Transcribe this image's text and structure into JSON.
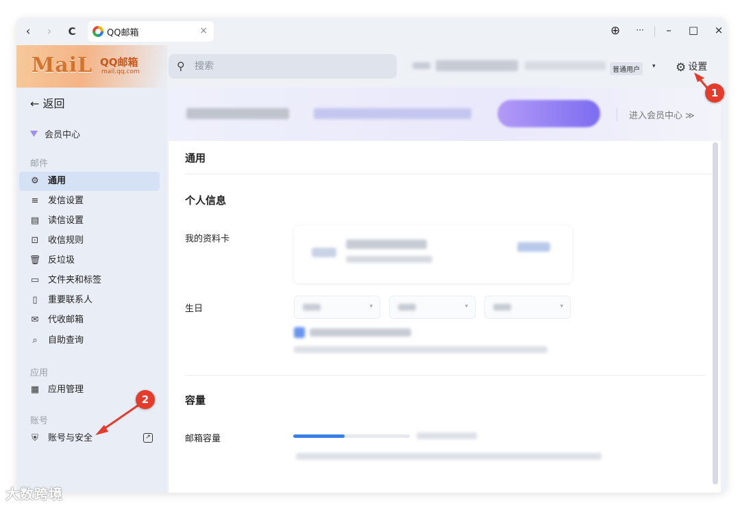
{
  "browser": {
    "back": "‹",
    "forward": "›",
    "reload": "C",
    "tab_title": "QQ邮箱",
    "tab_close": "×",
    "globe": "⊕",
    "more": "···",
    "minimize": "–",
    "maximize": "□",
    "close": "×"
  },
  "logo": {
    "wordmark": "MaiL",
    "brand": "QQ邮箱",
    "url": "mail.qq.com"
  },
  "header": {
    "search_placeholder": "搜索",
    "user_type": "普通用户",
    "user_caret": "▾",
    "settings_label": "设置"
  },
  "sidebar": {
    "back_label": "← 返回",
    "member_label": "会员中心",
    "sections": {
      "mail": "邮件",
      "apps": "应用",
      "account": "账号"
    },
    "items": [
      {
        "label": "通用",
        "icon": "⚙"
      },
      {
        "label": "发信设置",
        "icon": "≡"
      },
      {
        "label": "读信设置",
        "icon": "▤"
      },
      {
        "label": "收信规则",
        "icon": "⊡"
      },
      {
        "label": "反垃圾",
        "icon": "🗑"
      },
      {
        "label": "文件夹和标签",
        "icon": "▭"
      },
      {
        "label": "重要联系人",
        "icon": "▯"
      },
      {
        "label": "代收邮箱",
        "icon": "✉"
      },
      {
        "label": "自助查询",
        "icon": "⌕"
      }
    ],
    "app_items": [
      {
        "label": "应用管理",
        "icon": "▦"
      }
    ],
    "account_items": [
      {
        "label": "账号与安全",
        "icon": "⛨",
        "ext": "↗"
      }
    ]
  },
  "content": {
    "vip_center": "进入会员中心 ≫",
    "panel_title": "通用",
    "personal_info_heading": "个人信息",
    "profile_card_label": "我的资料卡",
    "birthday_label": "生日",
    "capacity_heading": "容量",
    "mailbox_capacity_label": "邮箱容量",
    "quota_fraction": 0.44
  },
  "annotations": {
    "badge_1": "1",
    "badge_2": "2",
    "color": "#e53b2c"
  },
  "watermark": "大数跨境"
}
